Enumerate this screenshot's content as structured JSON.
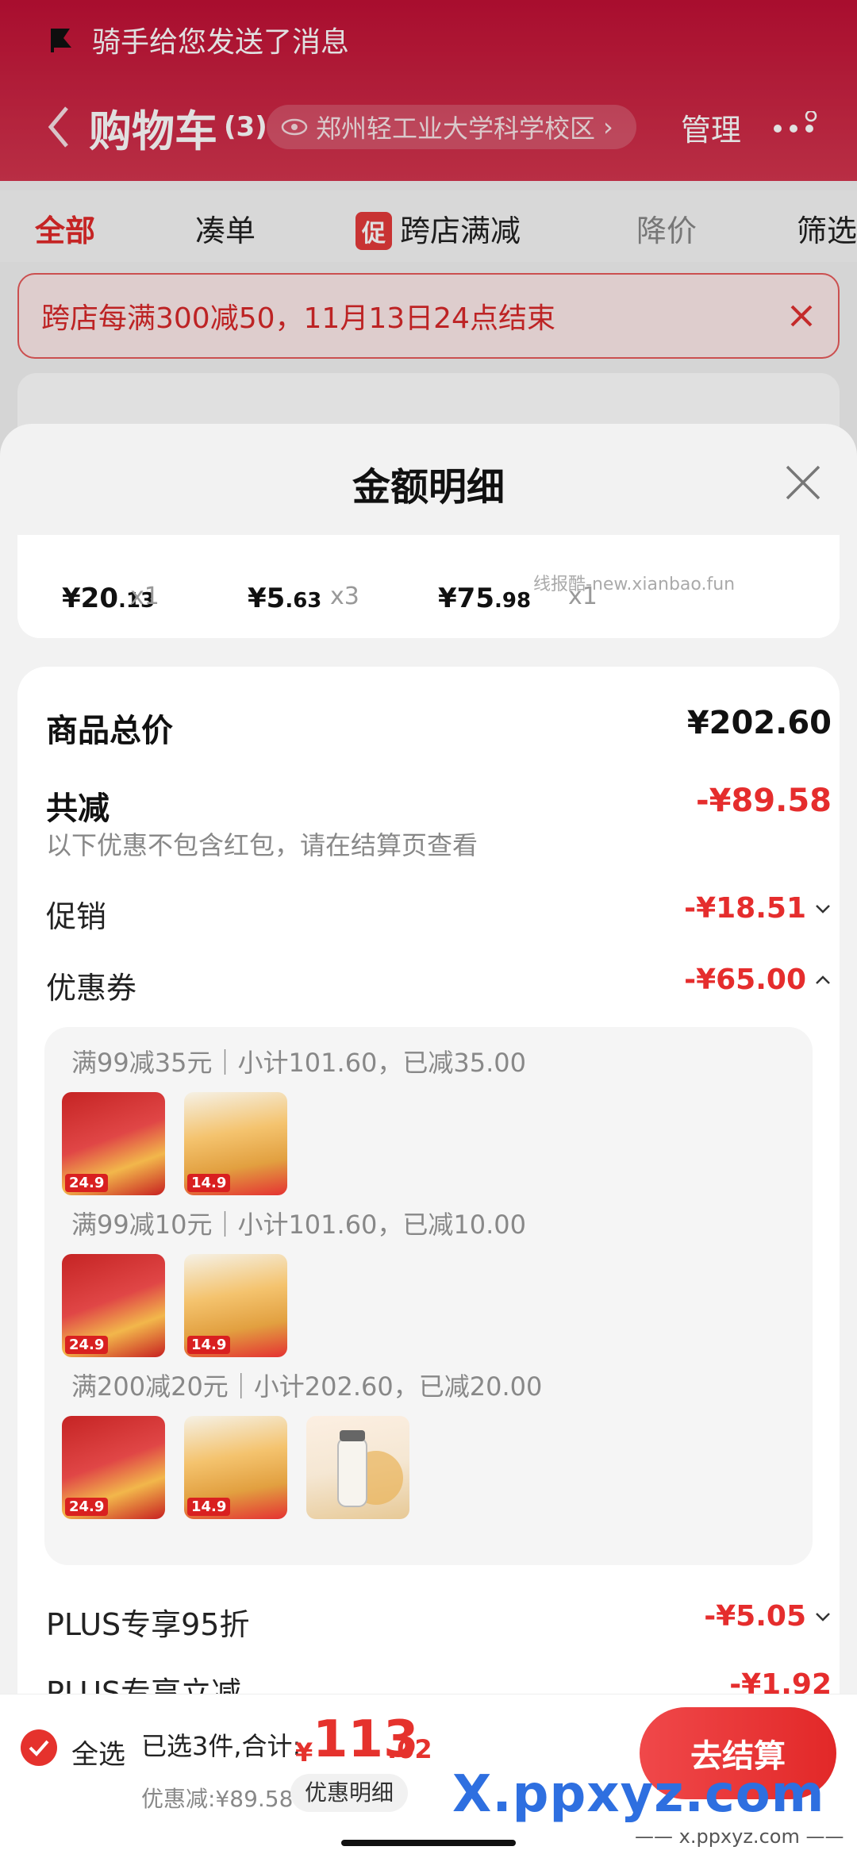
{
  "notification": {
    "text": "骑手给您发送了消息"
  },
  "header": {
    "title": "购物车",
    "count": "(3)",
    "address": "郑州轻工业大学科学校区",
    "address_arrow": "›",
    "manage": "管理"
  },
  "filters": {
    "tabs": [
      {
        "label": "全部",
        "state": "active"
      },
      {
        "label": "凑单",
        "state": "normal"
      },
      {
        "label": "跨店满减",
        "state": "normal",
        "tag": "促"
      },
      {
        "label": "降价",
        "state": "dim"
      },
      {
        "label": "筛选",
        "state": "normal"
      }
    ]
  },
  "banner": {
    "text": "跨店每满300减50，11月13日24点结束"
  },
  "sheet": {
    "title": "金额明细",
    "watermark": "线报酷-new.xianbao.fun",
    "items": [
      {
        "price_int": "¥20",
        "price_dec": ".13",
        "qty": "x1"
      },
      {
        "price_int": "¥5",
        "price_dec": ".63",
        "qty": "x3"
      },
      {
        "price_int": "¥75",
        "price_dec": ".98",
        "qty": "x1"
      }
    ],
    "goods_total_label": "商品总价",
    "goods_total_value": "¥202.60",
    "discount_label": "共减",
    "discount_value": "-¥89.58",
    "discount_note": "以下优惠不包含红包，请在结算页查看",
    "promo_label": "促销",
    "promo_value": "-¥18.51",
    "coupon_label": "优惠券",
    "coupon_value": "-¥65.00",
    "coupons": [
      {
        "title": "满99减35元｜小计101.60，已减35.00",
        "thumb_prices": [
          "24.9",
          "14.9"
        ]
      },
      {
        "title": "满99减10元｜小计101.60，已减10.00",
        "thumb_prices": [
          "24.9",
          "14.9"
        ]
      },
      {
        "title": "满200减20元｜小计202.60，已减20.00",
        "thumb_prices": [
          "24.9",
          "14.9",
          ""
        ]
      }
    ],
    "plus_label": "PLUS专享95折",
    "plus_value": "-¥5.05",
    "plus2_label": "PLUS专享立减",
    "plus2_value": "-¥1.92"
  },
  "bottom_bar": {
    "select_all": "全选",
    "summary": "已选3件,合计:",
    "total_prefix": "¥",
    "total_int": "113",
    "total_dec": ".02",
    "saved": "优惠减:¥89.58",
    "detail_button": "优惠明细",
    "checkout_button": "去结算"
  },
  "watermark_brand": {
    "text": "X.ppxyz.com",
    "sub": "—— x.ppxyz.com ——"
  },
  "colors": {
    "accent_red": "#e5322d",
    "header_red": "#c01035"
  }
}
